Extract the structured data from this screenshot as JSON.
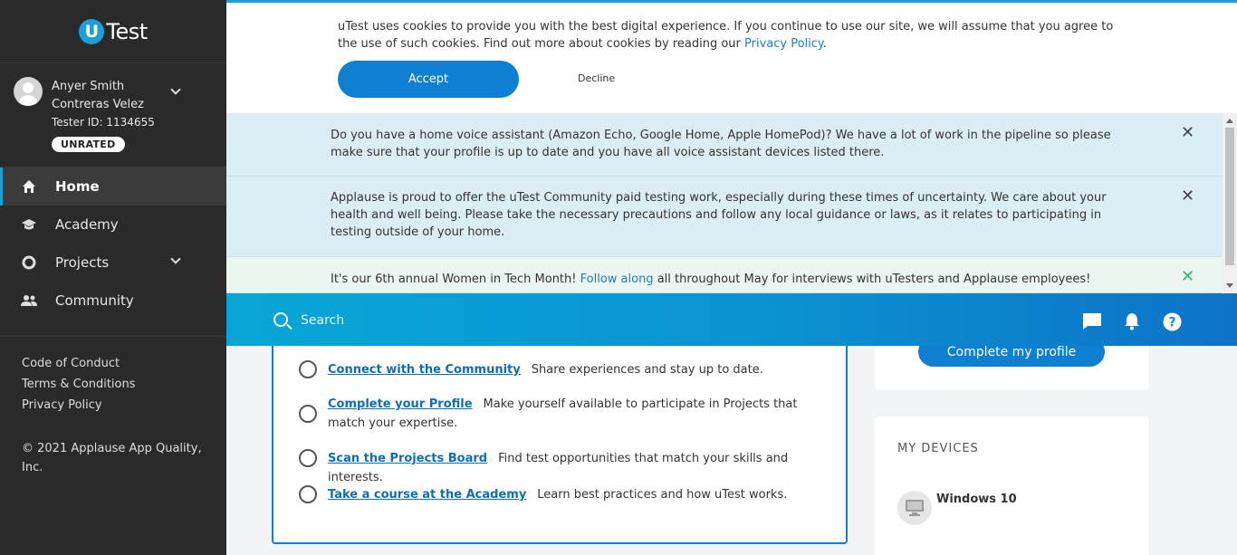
{
  "brand": {
    "logo_letter": "U",
    "logo_text": "Test",
    "accent": "#1b9fd9"
  },
  "profile": {
    "first_line": "Anyer Smith",
    "second_line": "Contreras Velez",
    "tester_id": "Tester ID: 1134655",
    "rating": "UNRATED"
  },
  "nav": {
    "home": "Home",
    "academy": "Academy",
    "projects": "Projects",
    "community": "Community"
  },
  "footer_links": {
    "code_of_conduct": "Code of Conduct",
    "terms": "Terms & Conditions",
    "privacy": "Privacy Policy",
    "copyright": "© 2021 Applause App Quality, Inc."
  },
  "cookie": {
    "text": "uTest uses cookies to provide you with the best digital experience. If you continue to use our site, we will assume that you agree to the use of such cookies. Find out more about cookies by reading our ",
    "link": "Privacy Policy",
    "text_end": ".",
    "accept": "Accept",
    "decline": "Decline"
  },
  "notices": {
    "voice": "Do you have a home voice assistant (Amazon Echo, Google Home, Apple HomePod)? We have a lot of work in the pipeline so please make sure that your profile is up to date and you have all voice assistant devices listed there.",
    "applause": "Applause is proud to offer the uTest Community paid testing work, especially during these times of uncertainty. We care about your health and well being. Please take the necessary precautions and follow any local guidance or laws, as it relates to participating in testing outside of your home.",
    "women_pre": "It's our 6th annual Women in Tech Month! ",
    "women_link": "Follow along",
    "women_post": " all throughout May for interviews with uTesters and Applause employees!",
    "close": "✕"
  },
  "search": {
    "placeholder": "Search"
  },
  "tasks": [
    {
      "link": "Connect with the Community",
      "desc": "Share experiences and stay up to date."
    },
    {
      "link": "Complete your Profile",
      "desc": "Make yourself available to participate in Projects that match your expertise."
    },
    {
      "link": "Scan the Projects Board",
      "desc": "Find test opportunities that match your skills and interests."
    },
    {
      "link": "Take a course at the Academy",
      "desc": "Learn best practices and how uTest works."
    }
  ],
  "profile_card": {
    "button": "Complete my profile"
  },
  "devices": {
    "title": "MY DEVICES",
    "items": [
      "Windows 10"
    ]
  }
}
